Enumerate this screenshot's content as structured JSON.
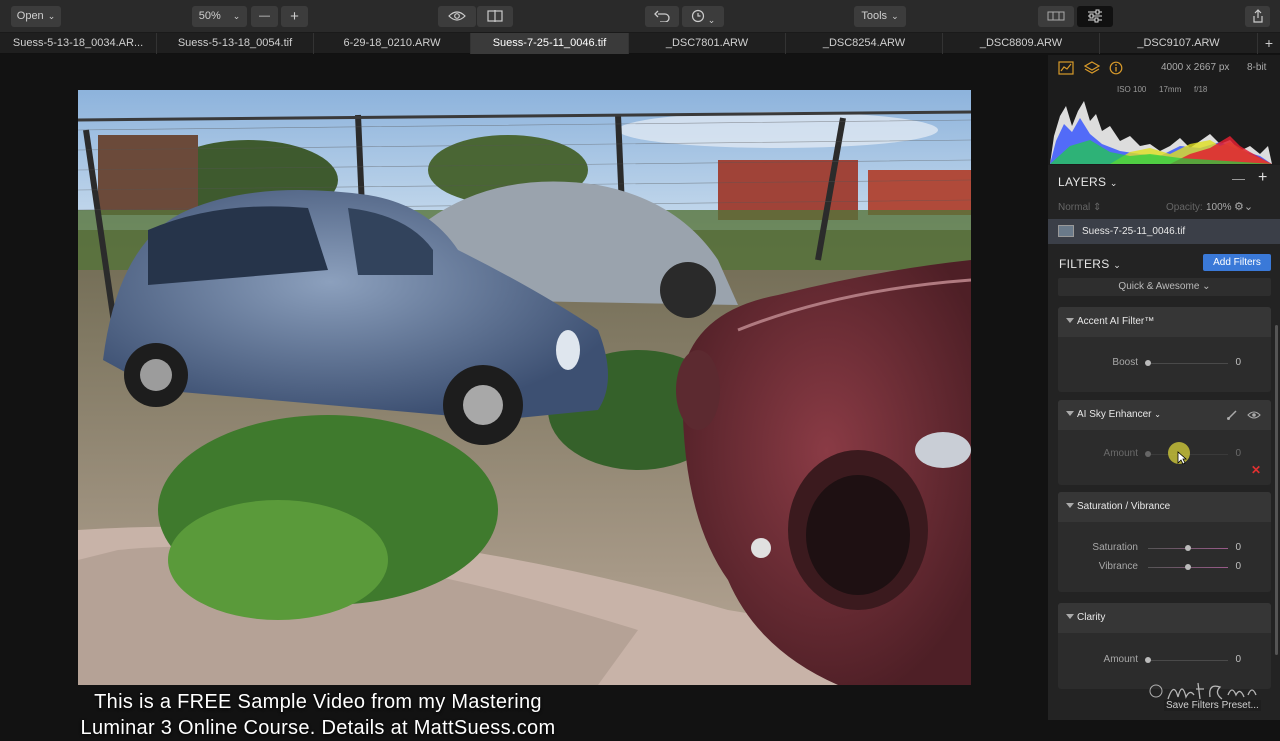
{
  "toolbar": {
    "open_label": "Open",
    "zoom_label": "50%",
    "zoom_out_label": "—",
    "zoom_in_label": "+",
    "tools_label": "Tools"
  },
  "tabs": [
    {
      "label": "Suess-5-13-18_0034.AR..."
    },
    {
      "label": "Suess-5-13-18_0054.tif"
    },
    {
      "label": "6-29-18_0210.ARW"
    },
    {
      "label": "Suess-7-25-11_0046.tif",
      "active": true
    },
    {
      "label": "_DSC7801.ARW"
    },
    {
      "label": "_DSC8254.ARW"
    },
    {
      "label": "_DSC8809.ARW"
    },
    {
      "label": "_DSC9107.ARW"
    }
  ],
  "overlay": {
    "line1": "This is a FREE Sample Video from my Mastering",
    "line2": "Luminar 3 Online Course. Details at MattSuess.com"
  },
  "info": {
    "dimensions": "4000 x 2667 px",
    "bit_depth": "8-bit",
    "iso": "ISO 100",
    "focal": "17mm",
    "aperture": "f/18"
  },
  "layers": {
    "title": "LAYERS",
    "blend_mode": "Normal",
    "opacity_label": "Opacity:",
    "opacity_value": "100%",
    "layer_name": "Suess-7-25-11_0046.tif",
    "minus": "—",
    "plus": "+"
  },
  "filters": {
    "title": "FILTERS",
    "add_label": "Add Filters",
    "workspace": "Quick & Awesome",
    "accent": {
      "name": "Accent AI Filter™",
      "boost_label": "Boost",
      "boost_value": "0",
      "boost_level": 0
    },
    "sky": {
      "name": "AI Sky Enhancer",
      "amount_label": "Amount",
      "amount_value": "0",
      "amount_level": 0
    },
    "satvib": {
      "name": "Saturation / Vibrance",
      "sat_label": "Saturation",
      "sat_value": "0",
      "sat_level": 0.5,
      "vib_label": "Vibrance",
      "vib_value": "0",
      "vib_level": 0.5
    },
    "clarity": {
      "name": "Clarity",
      "amount_label": "Amount",
      "amount_value": "0",
      "amount_level": 0
    },
    "save_presets": "Save Filters Preset..."
  },
  "colors": {
    "accent_blue": "#3a79d8",
    "icon_orange": "#d89a2a",
    "reset_red": "#e03030"
  }
}
